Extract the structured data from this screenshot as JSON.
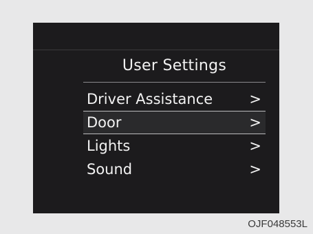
{
  "screen": {
    "title": "User Settings",
    "menu_items": [
      {
        "label": "Driver Assistance",
        "chevron": ">",
        "selected": false
      },
      {
        "label": "Door",
        "chevron": ">",
        "selected": true
      },
      {
        "label": "Lights",
        "chevron": ">",
        "selected": false
      },
      {
        "label": "Sound",
        "chevron": ">",
        "selected": false
      }
    ]
  },
  "figure_code": "OJF048553L",
  "colors": {
    "background": "#e8e8e9",
    "screen": "#1c1b1d",
    "text": "#f2f2f2",
    "selection_border": "#bdbdbf"
  }
}
